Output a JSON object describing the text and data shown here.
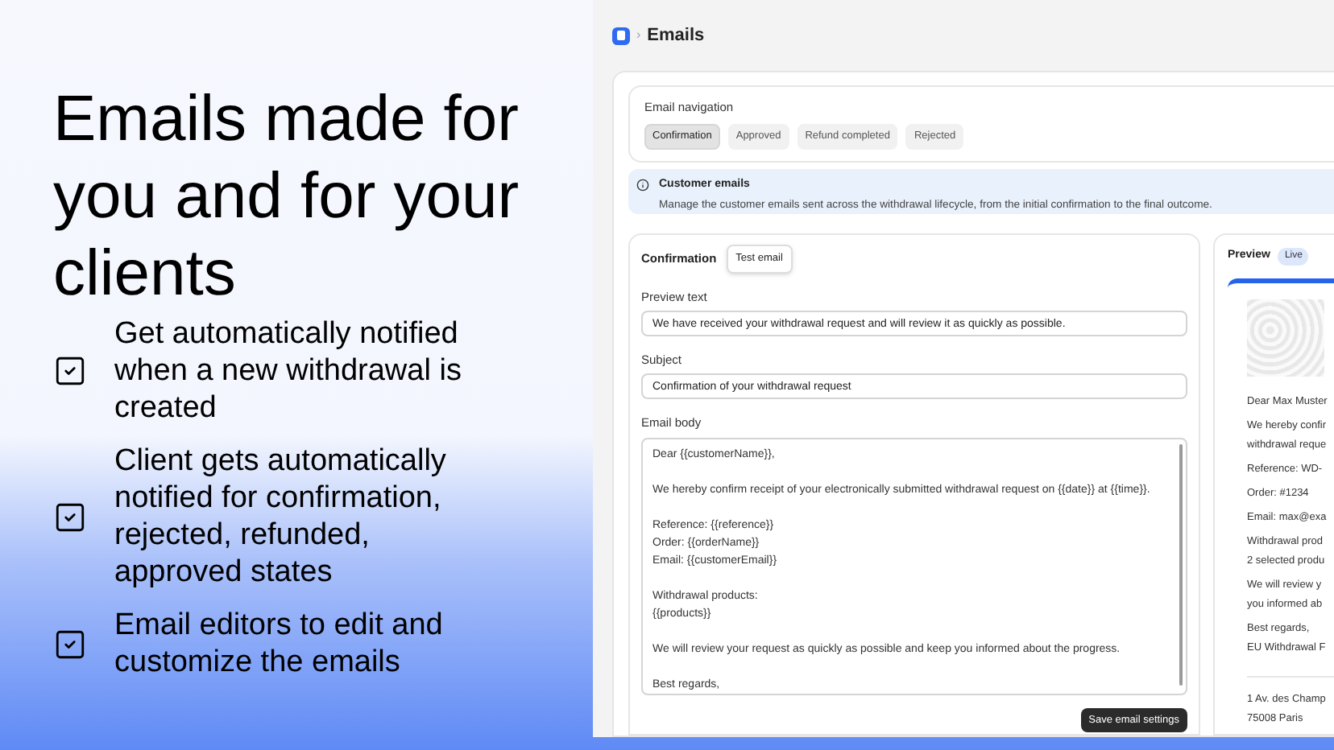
{
  "hero": {
    "heading": "Emails made for you and for your clients",
    "features": [
      {
        "text": "Get automatically notified when a new withdrawal is created",
        "checked": true
      },
      {
        "text": "Client gets automatically notified for confirmation, rejected, refunded, approved states",
        "checked": true
      },
      {
        "text": "Email editors to edit and customize the emails",
        "checked": true
      }
    ]
  },
  "app": {
    "breadcrumb": {
      "separator": "›",
      "title": "Emails"
    },
    "navigation": {
      "label": "Email navigation",
      "tabs": [
        {
          "label": "Confirmation",
          "selected": true
        },
        {
          "label": "Approved",
          "selected": false
        },
        {
          "label": "Refund completed",
          "selected": false
        },
        {
          "label": "Rejected",
          "selected": false
        }
      ]
    },
    "banner": {
      "title": "Customer emails",
      "text": "Manage the customer emails sent across the withdrawal lifecycle, from the initial confirmation to the final outcome."
    },
    "editor": {
      "title": "Confirmation",
      "test_button": "Test email",
      "fields": [
        {
          "label": "Preview text",
          "value": "We have received your withdrawal request and will review it as quickly as possible."
        },
        {
          "label": "Subject",
          "value": "Confirmation of your withdrawal request"
        }
      ],
      "body_label": "Email body",
      "body_paragraphs": [
        [
          "Dear {{customerName}},"
        ],
        [
          "We hereby confirm receipt of your electronically submitted withdrawal request on {{date}} at {{time}}."
        ],
        [
          "Reference: {{reference}}",
          "Order: {{orderName}}",
          "Email: {{customerEmail}}"
        ],
        [
          "Withdrawal products:",
          "{{products}}"
        ],
        [
          "We will review your request as quickly as possible and keep you informed about the progress."
        ],
        [
          "Best regards,"
        ]
      ],
      "save_button": "Save email settings"
    },
    "preview": {
      "title": "Preview",
      "badge": "Live",
      "blocks": [
        [
          "Dear Max Muster"
        ],
        [
          "We hereby confir",
          "withdrawal reque"
        ],
        [
          "Reference: WD-"
        ],
        [
          "Order: #1234"
        ],
        [
          "Email: max@exa"
        ],
        [
          "Withdrawal prod",
          "2 selected produ"
        ],
        [
          "We will review y",
          "you informed ab"
        ],
        [
          "Best regards,",
          "EU Withdrawal F"
        ]
      ],
      "footer": [
        "1 Av. des Champ",
        "75008 Paris"
      ]
    }
  }
}
